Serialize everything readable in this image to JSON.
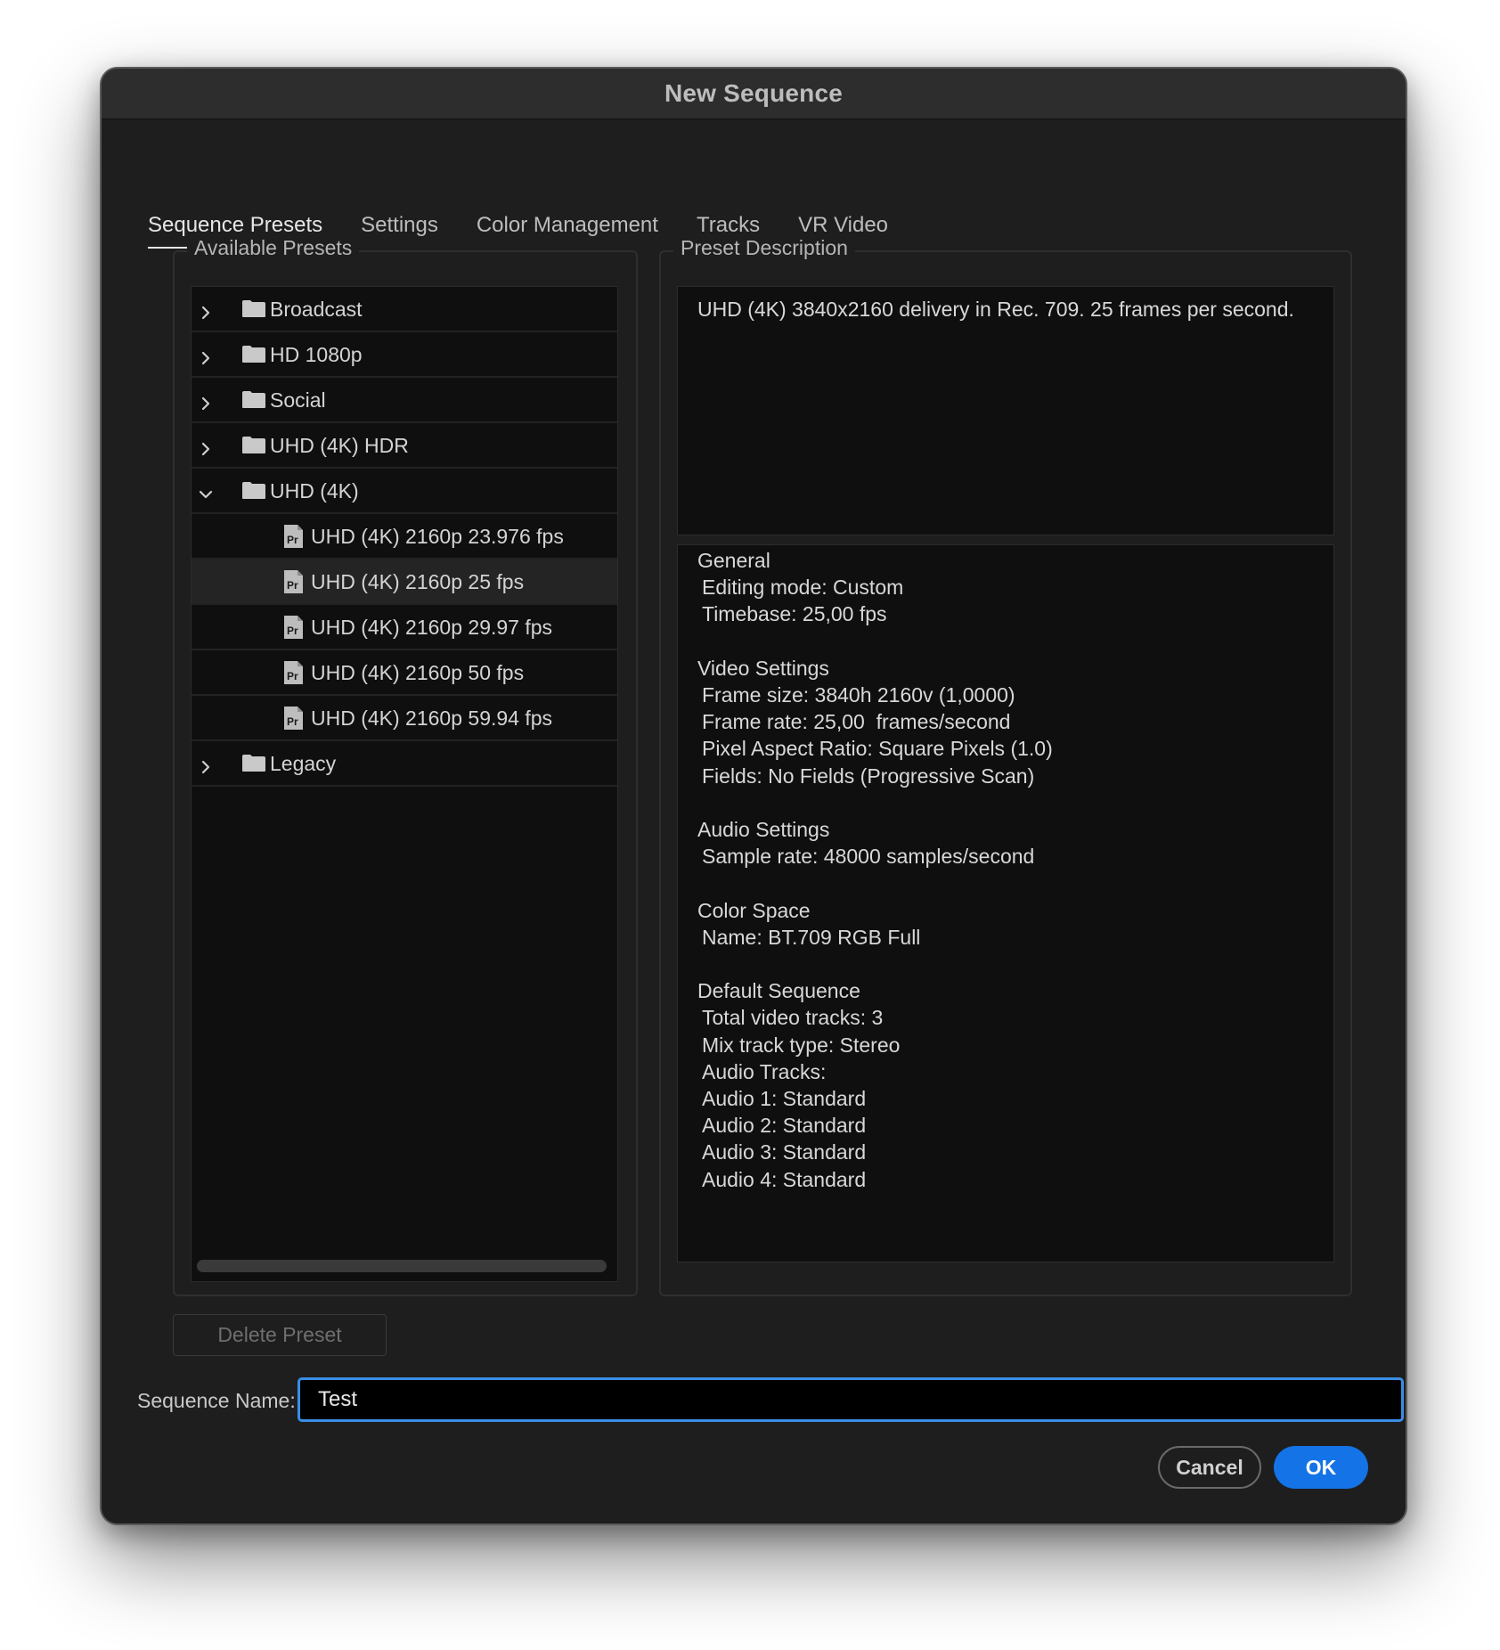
{
  "window": {
    "title": "New Sequence"
  },
  "tabs": [
    {
      "label": "Sequence Presets",
      "active": true
    },
    {
      "label": "Settings",
      "active": false
    },
    {
      "label": "Color Management",
      "active": false
    },
    {
      "label": "Tracks",
      "active": false
    },
    {
      "label": "VR Video",
      "active": false
    }
  ],
  "presets": {
    "legend": "Available Presets",
    "items": [
      {
        "label": "Broadcast",
        "type": "folder",
        "expanded": false
      },
      {
        "label": "HD 1080p",
        "type": "folder",
        "expanded": false
      },
      {
        "label": "Social",
        "type": "folder",
        "expanded": false
      },
      {
        "label": "UHD (4K) HDR",
        "type": "folder",
        "expanded": false
      },
      {
        "label": "UHD (4K)",
        "type": "folder",
        "expanded": true
      },
      {
        "label": "UHD (4K) 2160p 23.976 fps",
        "type": "preset"
      },
      {
        "label": "UHD (4K) 2160p 25 fps",
        "type": "preset",
        "selected": true
      },
      {
        "label": "UHD (4K) 2160p 29.97 fps",
        "type": "preset"
      },
      {
        "label": "UHD (4K) 2160p 50 fps",
        "type": "preset"
      },
      {
        "label": "UHD (4K) 2160p 59.94 fps",
        "type": "preset"
      },
      {
        "label": "Legacy",
        "type": "folder",
        "expanded": false
      }
    ]
  },
  "description": {
    "legend": "Preset Description",
    "summary": "UHD (4K) 3840x2160 delivery in Rec. 709. 25 frames per second.",
    "details": [
      {
        "text": "General",
        "indent": false
      },
      {
        "text": "Editing mode: Custom",
        "indent": true
      },
      {
        "text": "Timebase: 25,00 fps",
        "indent": true
      },
      {
        "text": "",
        "indent": false
      },
      {
        "text": "Video Settings",
        "indent": false
      },
      {
        "text": "Frame size: 3840h 2160v (1,0000)",
        "indent": true
      },
      {
        "text": "Frame rate: 25,00  frames/second",
        "indent": true
      },
      {
        "text": "Pixel Aspect Ratio: Square Pixels (1.0)",
        "indent": true
      },
      {
        "text": "Fields: No Fields (Progressive Scan)",
        "indent": true
      },
      {
        "text": "",
        "indent": false
      },
      {
        "text": "Audio Settings",
        "indent": false
      },
      {
        "text": "Sample rate: 48000 samples/second",
        "indent": true
      },
      {
        "text": "",
        "indent": false
      },
      {
        "text": "Color Space",
        "indent": false
      },
      {
        "text": "Name: BT.709 RGB Full",
        "indent": true
      },
      {
        "text": "",
        "indent": false
      },
      {
        "text": "Default Sequence",
        "indent": false
      },
      {
        "text": "Total video tracks: 3",
        "indent": true
      },
      {
        "text": "Mix track type: Stereo",
        "indent": true
      },
      {
        "text": "Audio Tracks:",
        "indent": true
      },
      {
        "text": "Audio 1: Standard",
        "indent": true
      },
      {
        "text": "Audio 2: Standard",
        "indent": true
      },
      {
        "text": "Audio 3: Standard",
        "indent": true
      },
      {
        "text": "Audio 4: Standard",
        "indent": true
      }
    ]
  },
  "footer": {
    "delete_label": "Delete Preset",
    "sequence_name_label": "Sequence Name:",
    "sequence_name_value": "Test",
    "cancel_label": "Cancel",
    "ok_label": "OK"
  },
  "colors": {
    "accent": "#1473e6",
    "focus_ring": "#3a8ee6",
    "window_bg": "#1e1e1e",
    "panel_bg": "#0f0f0f"
  },
  "icons": {
    "collapsed": "chevron-right-icon",
    "expanded": "chevron-down-icon",
    "folder": "folder-icon",
    "preset": "premiere-preset-icon"
  }
}
